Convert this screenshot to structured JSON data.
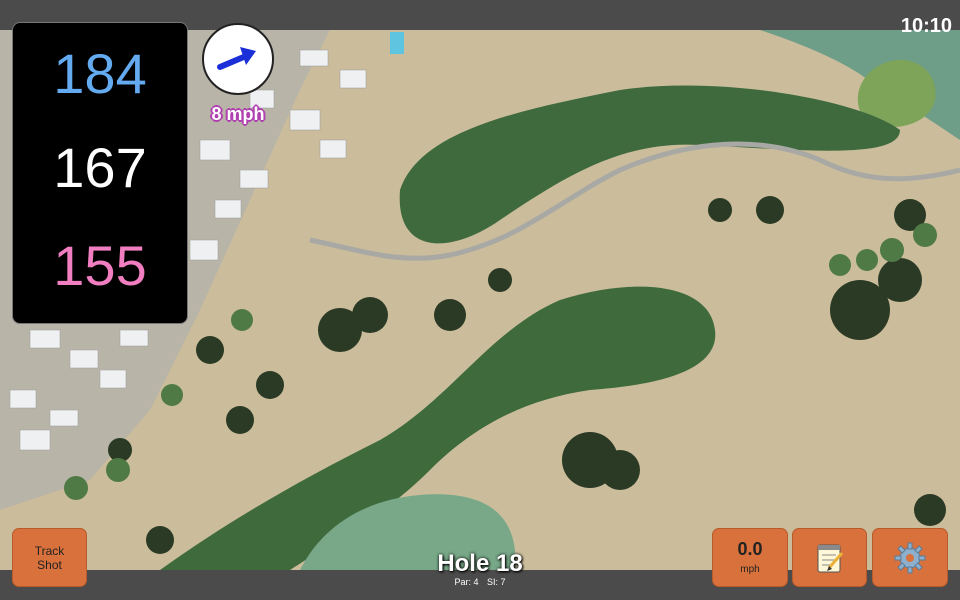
{
  "status": {
    "time": "10:10"
  },
  "yardages": {
    "back": "184",
    "middle": "167",
    "front": "155"
  },
  "wind": {
    "speed_label": "8 mph"
  },
  "hole": {
    "title": "Hole 18",
    "par": "Par: 4",
    "si": "SI: 7"
  },
  "buttons": {
    "track_shot_line1": "Track",
    "track_shot_line2": "Shot",
    "speed_value": "0.0",
    "speed_unit": "mph",
    "notes_icon": "notepad-icon",
    "settings_icon": "gear-icon"
  },
  "colors": {
    "back_yardage": "#64aaf0",
    "middle_yardage": "#ffffff",
    "front_yardage": "#f07ec0",
    "button": "#d9713c",
    "wind_arrow": "#1a2fd8",
    "wind_label_outline": "#b040b0"
  }
}
